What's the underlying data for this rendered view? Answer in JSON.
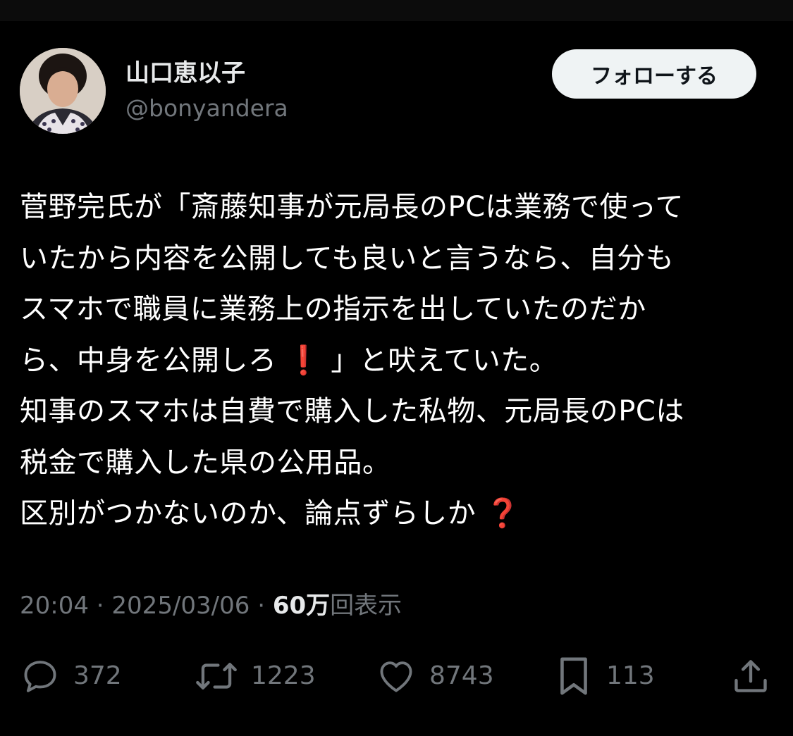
{
  "author": {
    "name": "山口恵以子",
    "handle": "@bonyandera"
  },
  "follow_button_label": "フォローする",
  "tweet": {
    "lines": [
      "菅野完氏が「斎藤知事が元局長のPCは業務で使って",
      "いたから内容を公開しても良いと言うなら、自分も",
      "スマホで職員に業務上の指示を出していたのだか"
    ],
    "line4_before": "ら、中身を公開しろ",
    "line4_emoji": "❗",
    "line4_after": "」と吠えていた。",
    "line5": "知事のスマホは自費で購入した私物、元局長のPCは",
    "line6": "税金で購入した県の公用品。",
    "line7_text": "区別がつかないのか、論点ずらしか",
    "line7_emoji": "❓"
  },
  "meta": {
    "time": "20:04",
    "separator": "·",
    "date": "2025/03/06",
    "views_count": "60万",
    "views_label": "回表示"
  },
  "actions": {
    "replies": "372",
    "reposts": "1223",
    "likes": "8743",
    "bookmarks": "113"
  },
  "icons": {
    "reply": "reply-icon",
    "repost": "repost-icon",
    "like": "heart-icon",
    "bookmark": "bookmark-icon",
    "share": "share-icon"
  },
  "colors": {
    "background": "#000000",
    "text": "#ffffff",
    "secondary": "#71767b",
    "follow_bg": "#eff3f4",
    "emoji_red": "#dd1f1f"
  }
}
